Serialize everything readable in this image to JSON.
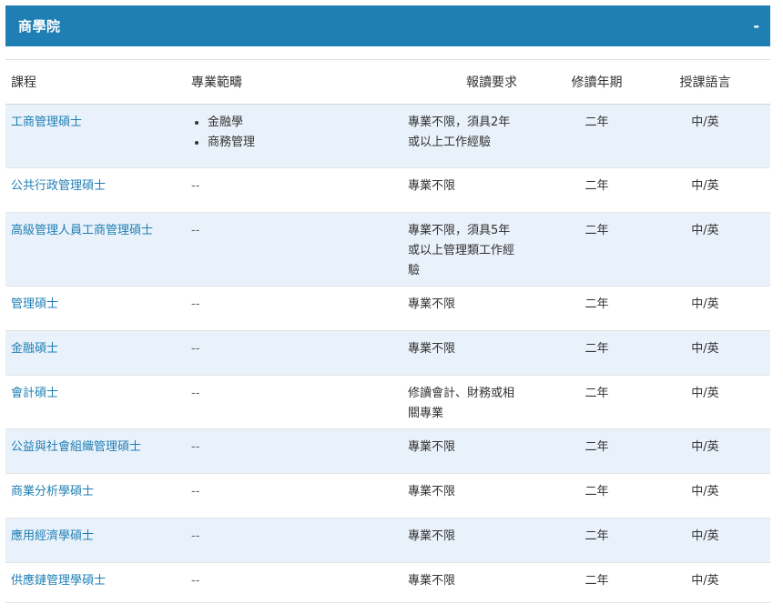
{
  "panel": {
    "title": "商學院",
    "toggle": "-"
  },
  "headers": {
    "course": "課程",
    "scope": "專業範疇",
    "requirement": "報讀要求",
    "years": "修讀年期",
    "language": "授課語言"
  },
  "rows": [
    {
      "course": "工商管理碩士",
      "scope": [
        "金融學",
        "商務管理"
      ],
      "requirement": [
        "專業不限，須具2年",
        "或以上工作經驗"
      ],
      "years": "二年",
      "language": "中/英"
    },
    {
      "course": "公共行政管理碩士",
      "scope_text": "--",
      "requirement": [
        "專業不限"
      ],
      "years": "二年",
      "language": "中/英"
    },
    {
      "course": "高級管理人員工商管理碩士",
      "scope_text": "--",
      "requirement": [
        "專業不限，須具5年",
        "或以上管理類工作經",
        "驗"
      ],
      "years": "二年",
      "language": "中/英"
    },
    {
      "course": "管理碩士",
      "scope_text": "--",
      "requirement": [
        "專業不限"
      ],
      "years": "二年",
      "language": "中/英"
    },
    {
      "course": "金融碩士",
      "scope_text": "--",
      "requirement": [
        "專業不限"
      ],
      "years": "二年",
      "language": "中/英"
    },
    {
      "course": "會計碩士",
      "scope_text": "--",
      "requirement": [
        "修讀會計、財務或相",
        "關專業"
      ],
      "years": "二年",
      "language": "中/英"
    },
    {
      "course": "公益與社會組織管理碩士",
      "scope_text": "--",
      "requirement": [
        "專業不限"
      ],
      "years": "二年",
      "language": "中/英"
    },
    {
      "course": "商業分析學碩士",
      "scope_text": "--",
      "requirement": [
        "專業不限"
      ],
      "years": "二年",
      "language": "中/英"
    },
    {
      "course": "應用經濟學碩士",
      "scope_text": "--",
      "requirement": [
        "專業不限"
      ],
      "years": "二年",
      "language": "中/英"
    },
    {
      "course": "供應鏈管理學碩士",
      "scope_text": "--",
      "requirement": [
        "專業不限"
      ],
      "years": "二年",
      "language": "中/英"
    }
  ]
}
